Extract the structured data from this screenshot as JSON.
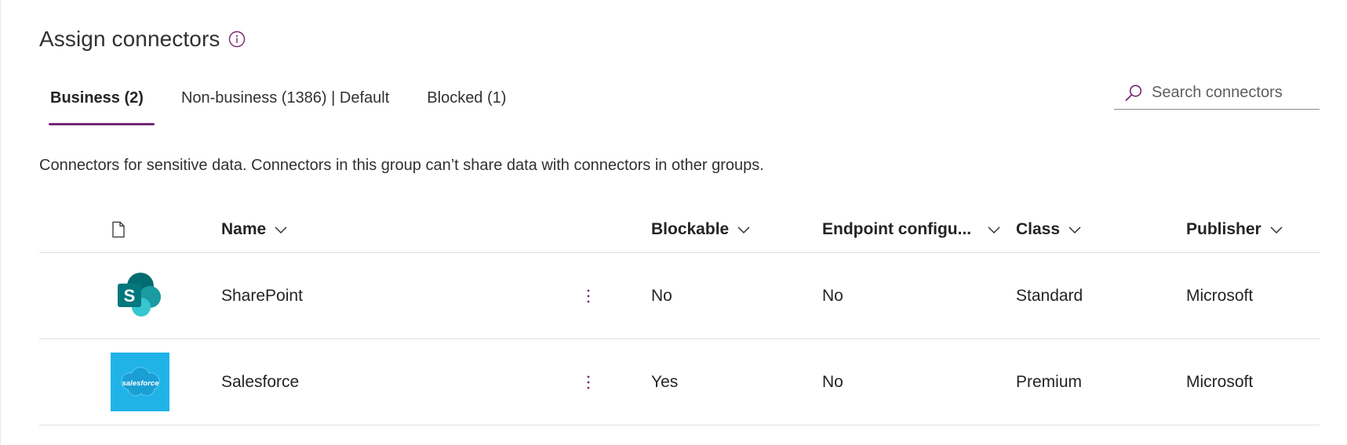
{
  "header": {
    "title": "Assign connectors"
  },
  "tabs": [
    {
      "label": "Business (2)",
      "active": true
    },
    {
      "label": "Non-business (1386) | Default",
      "active": false
    },
    {
      "label": "Blocked (1)",
      "active": false
    }
  ],
  "search": {
    "placeholder": "Search connectors",
    "value": ""
  },
  "description": "Connectors for sensitive data. Connectors in this group can’t share data with connectors in other groups.",
  "table": {
    "columns": {
      "icon": "file-icon",
      "name": "Name",
      "blockable": "Blockable",
      "endpoint": "Endpoint configu...",
      "class": "Class",
      "publisher": "Publisher"
    },
    "rows": [
      {
        "name": "SharePoint",
        "icon": "sharepoint-logo",
        "blockable": "No",
        "endpoint": "No",
        "class": "Standard",
        "publisher": "Microsoft"
      },
      {
        "name": "Salesforce",
        "icon": "salesforce-logo",
        "logo_text": "salesforce",
        "blockable": "Yes",
        "endpoint": "No",
        "class": "Premium",
        "publisher": "Microsoft"
      }
    ]
  },
  "colors": {
    "accent": "#742774",
    "sharepoint_dark": "#036C70",
    "sharepoint_mid": "#1A9BA1",
    "sharepoint_light": "#37C6D0",
    "salesforce_blue": "#1FB3E8"
  }
}
